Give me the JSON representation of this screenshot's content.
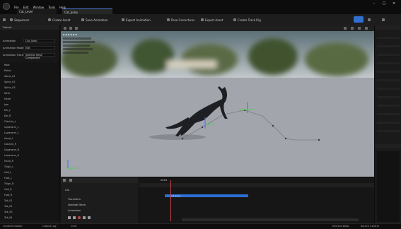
{
  "menu": {
    "items": [
      "File",
      "Edit",
      "Window",
      "Tools",
      "Help"
    ]
  },
  "tabs": {
    "tab1": "Cat_Level",
    "tab2": "Cat_Jump"
  },
  "toolbar": {
    "items": [
      "Sequencer",
      "Create Asset",
      "Save Animation",
      "Export Animation",
      "Pose Correctives",
      "Export Asset",
      "Create Track Rig"
    ]
  },
  "left_panel": {
    "header": "Details",
    "rows": [
      {
        "label": "Animation",
        "value": "Cat_Jump"
      },
      {
        "label": "Animation Mode",
        "value": "Edit"
      },
      {
        "label": "Animation Track",
        "value": "Skeletal Mesh Component"
      }
    ],
    "tree": [
      "Root",
      "Pelvis",
      "Spine_01",
      "Spine_02",
      "Spine_03",
      "Neck",
      "Head",
      "Jaw",
      "Ear_L",
      "Ear_R",
      "Clavicle_L",
      "Upperarm_L",
      "Lowerarm_L",
      "Hand_L",
      "Clavicle_R",
      "Upperarm_R",
      "Lowerarm_R",
      "Hand_R",
      "Thigh_L",
      "Calf_L",
      "Foot_L",
      "Thigh_R",
      "Calf_R",
      "Foot_R",
      "Tail_01",
      "Tail_02",
      "Tail_03",
      "Tail_04"
    ]
  },
  "viewport": {
    "colors": {
      "floor": "#a3a5ad",
      "cat": "#1e1f22",
      "trajectory": "#7d7d82",
      "accent_blue": "#3e6ee8",
      "accent_green": "#4ad14a"
    }
  },
  "sequencer": {
    "frame_display": "0024",
    "tracks": [
      "Cat",
      "Transform",
      "Skeletal Mesh",
      "Animation"
    ],
    "section_label": "Cat_Jump"
  },
  "status_bar": {
    "items": [
      "Content Drawer",
      "Output Log",
      "Cmd",
      "Derived Data",
      "Source Control"
    ]
  }
}
